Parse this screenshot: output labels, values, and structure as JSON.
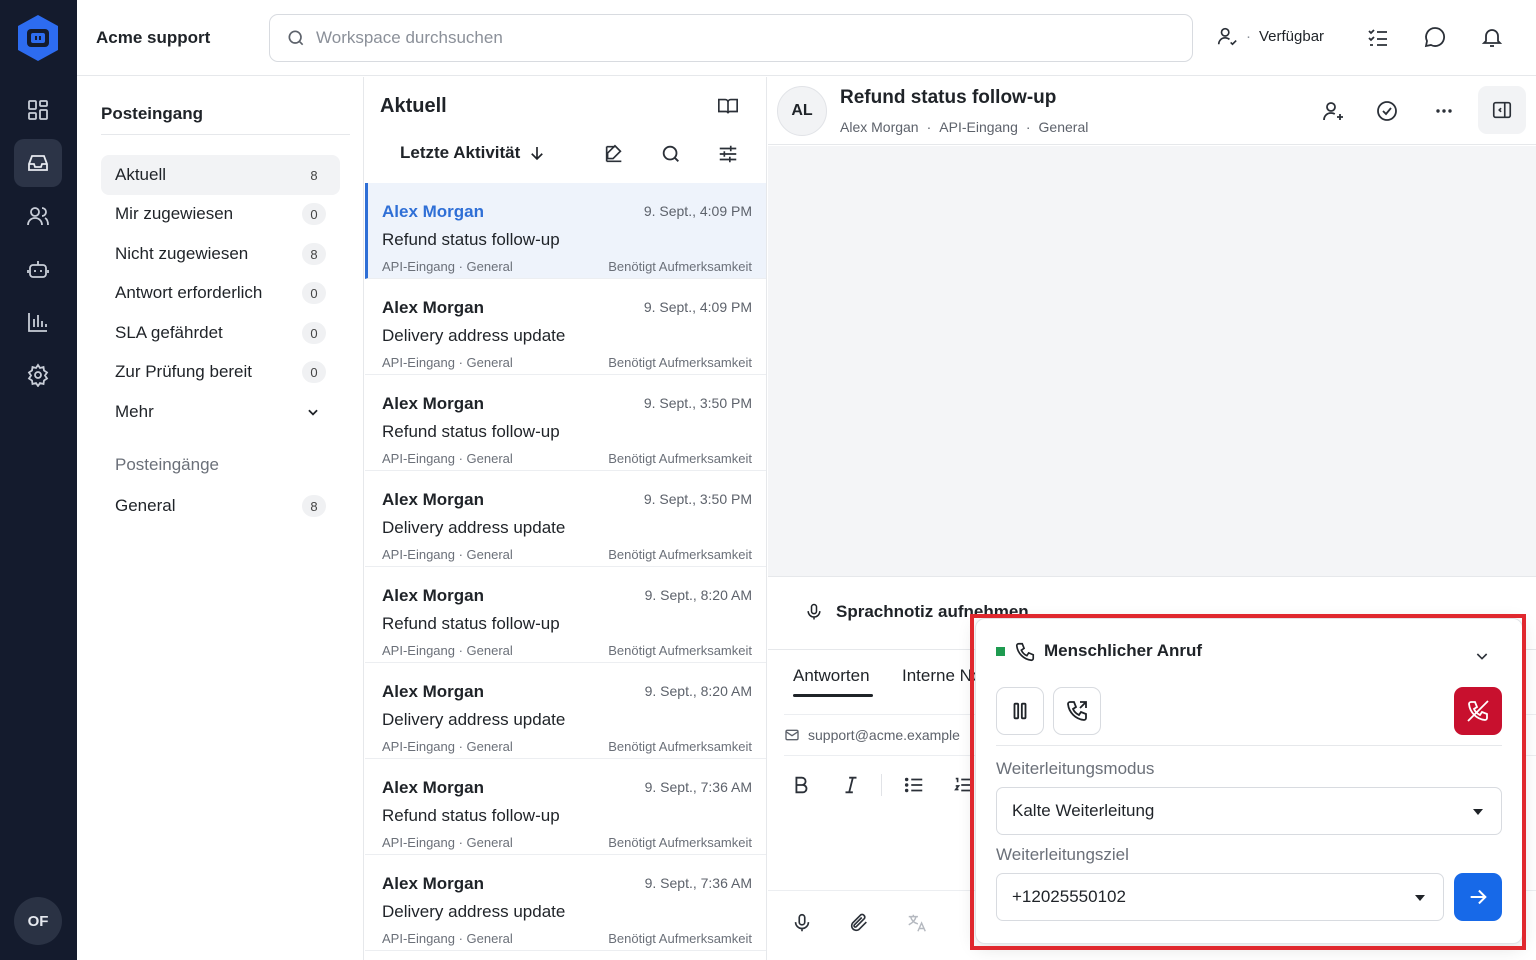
{
  "topbar": {
    "workspace": "Acme support",
    "search_placeholder": "Workspace durchsuchen",
    "status_separator": "·",
    "status": "Verfügbar"
  },
  "rail": {
    "items": [
      "dashboard-icon",
      "inbox-icon",
      "contacts-icon",
      "bot-icon",
      "reports-icon",
      "settings-icon"
    ],
    "active": "inbox-icon",
    "avatar": "OF"
  },
  "nav": {
    "title": "Posteingang",
    "items": [
      {
        "label": "Aktuell",
        "count": "8"
      },
      {
        "label": "Mir zugewiesen",
        "count": "0"
      },
      {
        "label": "Nicht zugewiesen",
        "count": "8"
      },
      {
        "label": "Antwort erforderlich",
        "count": "0"
      },
      {
        "label": "SLA gefährdet",
        "count": "0"
      },
      {
        "label": "Zur Prüfung bereit",
        "count": "0"
      },
      {
        "label": "Mehr",
        "count": ""
      }
    ],
    "section": "Posteingänge",
    "inboxes": [
      {
        "label": "General",
        "count": "8"
      }
    ]
  },
  "list": {
    "title": "Aktuell",
    "sort": "Letzte Aktivität",
    "conversations": [
      {
        "name": "Alex Morgan",
        "time": "9. Sept., 4:09 PM",
        "subject": "Refund status follow-up",
        "meta": "API-Eingang · General",
        "tag": "Benötigt Aufmerksamkeit"
      },
      {
        "name": "Alex Morgan",
        "time": "9. Sept., 4:09 PM",
        "subject": "Delivery address update",
        "meta": "API-Eingang · General",
        "tag": "Benötigt Aufmerksamkeit"
      },
      {
        "name": "Alex Morgan",
        "time": "9. Sept., 3:50 PM",
        "subject": "Refund status follow-up",
        "meta": "API-Eingang · General",
        "tag": "Benötigt Aufmerksamkeit"
      },
      {
        "name": "Alex Morgan",
        "time": "9. Sept., 3:50 PM",
        "subject": "Delivery address update",
        "meta": "API-Eingang · General",
        "tag": "Benötigt Aufmerksamkeit"
      },
      {
        "name": "Alex Morgan",
        "time": "9. Sept., 8:20 AM",
        "subject": "Refund status follow-up",
        "meta": "API-Eingang · General",
        "tag": "Benötigt Aufmerksamkeit"
      },
      {
        "name": "Alex Morgan",
        "time": "9. Sept., 8:20 AM",
        "subject": "Delivery address update",
        "meta": "API-Eingang · General",
        "tag": "Benötigt Aufmerksamkeit"
      },
      {
        "name": "Alex Morgan",
        "time": "9. Sept., 7:36 AM",
        "subject": "Refund status follow-up",
        "meta": "API-Eingang · General",
        "tag": "Benötigt Aufmerksamkeit"
      },
      {
        "name": "Alex Morgan",
        "time": "9. Sept., 7:36 AM",
        "subject": "Delivery address update",
        "meta": "API-Eingang · General",
        "tag": "Benötigt Aufmerksamkeit"
      }
    ]
  },
  "pane": {
    "avatar": "AL",
    "title": "Refund status follow-up",
    "contact": "Alex Morgan",
    "dot1": "·",
    "inbox": "API-Eingang",
    "dot2": "·",
    "team": "General",
    "voice_note": "Sprachnotiz aufnehmen",
    "tabs": [
      "Antworten",
      "Interne Notiz"
    ],
    "from": "support@acme.example"
  },
  "call": {
    "title": "Menschlicher Anruf",
    "status_color": "#1e9b50",
    "mode_label": "Weiterleitungsmodus",
    "mode_value": "Kalte Weiterleitung",
    "target_label": "Weiterleitungsziel",
    "target_value": "+12025550102"
  },
  "colors": {
    "accent": "#2f6fd6",
    "hangup": "#c8102e",
    "go": "#1769e8",
    "highlight": "#e0282e",
    "rail": "#141b2d"
  }
}
